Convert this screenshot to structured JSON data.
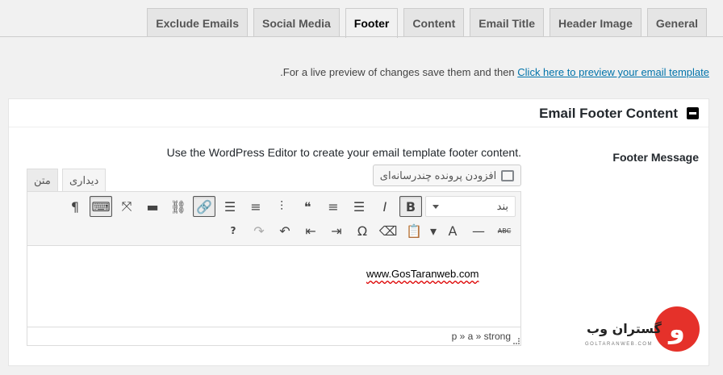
{
  "tabs": [
    {
      "label": "General",
      "active": false
    },
    {
      "label": "Header Image",
      "active": false
    },
    {
      "label": "Email Title",
      "active": false
    },
    {
      "label": "Content",
      "active": false
    },
    {
      "label": "Footer",
      "active": true
    },
    {
      "label": "Social Media",
      "active": false
    },
    {
      "label": "Exclude Emails",
      "active": false
    }
  ],
  "preview": {
    "text": "For a live preview of changes save them and then",
    "link": "Click here to preview your email template",
    "suffix": "."
  },
  "postbox": {
    "title": "Email Footer Content",
    "field_label": "Footer Message",
    "description": "Use the WordPress Editor to create your email template footer content."
  },
  "editor": {
    "add_media": "افزودن پرونده چندرسانه‌ای",
    "mode_visual": "دیداری",
    "mode_text": "متن",
    "format_select": "بند",
    "content": "www.GosTaranweb.com",
    "path": "p » a » strong"
  },
  "toolbar_row1": [
    {
      "name": "bold-icon",
      "glyph": "B",
      "pressed": true
    },
    {
      "name": "italic-icon",
      "glyph": "I"
    },
    {
      "name": "bullet-list-icon",
      "glyph": "☰"
    },
    {
      "name": "numbered-list-icon",
      "glyph": "≡"
    },
    {
      "name": "blockquote-icon",
      "glyph": "❝"
    },
    {
      "name": "align-left-icon",
      "glyph": "⫶"
    },
    {
      "name": "align-center-icon",
      "glyph": "≡"
    },
    {
      "name": "align-right-icon",
      "glyph": "☰"
    },
    {
      "name": "link-icon",
      "glyph": "🔗",
      "pressed": true
    },
    {
      "name": "unlink-icon",
      "glyph": "⛓"
    },
    {
      "name": "read-more-icon",
      "glyph": "▬"
    },
    {
      "name": "fullscreen-icon",
      "glyph": "⤧"
    },
    {
      "name": "toolbar-toggle-icon",
      "glyph": "⌨",
      "pressed": true
    },
    {
      "name": "paragraph-icon",
      "glyph": "¶"
    }
  ],
  "toolbar_row2": [
    {
      "name": "strikethrough-icon",
      "glyph": "ABC"
    },
    {
      "name": "horizontal-line-icon",
      "glyph": "—"
    },
    {
      "name": "text-color-icon",
      "glyph": "A"
    },
    {
      "name": "color-dropdown-icon",
      "glyph": "▾"
    },
    {
      "name": "paste-text-icon",
      "glyph": "📋"
    },
    {
      "name": "clear-formatting-icon",
      "glyph": "⌫"
    },
    {
      "name": "special-character-icon",
      "glyph": "Ω"
    },
    {
      "name": "indent-icon",
      "glyph": "⇥"
    },
    {
      "name": "outdent-icon",
      "glyph": "⇤"
    },
    {
      "name": "undo-icon",
      "glyph": "↶"
    },
    {
      "name": "redo-icon",
      "glyph": "↷",
      "dim": true
    },
    {
      "name": "help-icon",
      "glyph": "?"
    }
  ],
  "logo": {
    "mark": "و",
    "text": "گستران وب",
    "sub": "GOLTARANWEB.COM"
  },
  "colors": {
    "accent": "#0073aa",
    "logo_red": "#e5312a"
  }
}
